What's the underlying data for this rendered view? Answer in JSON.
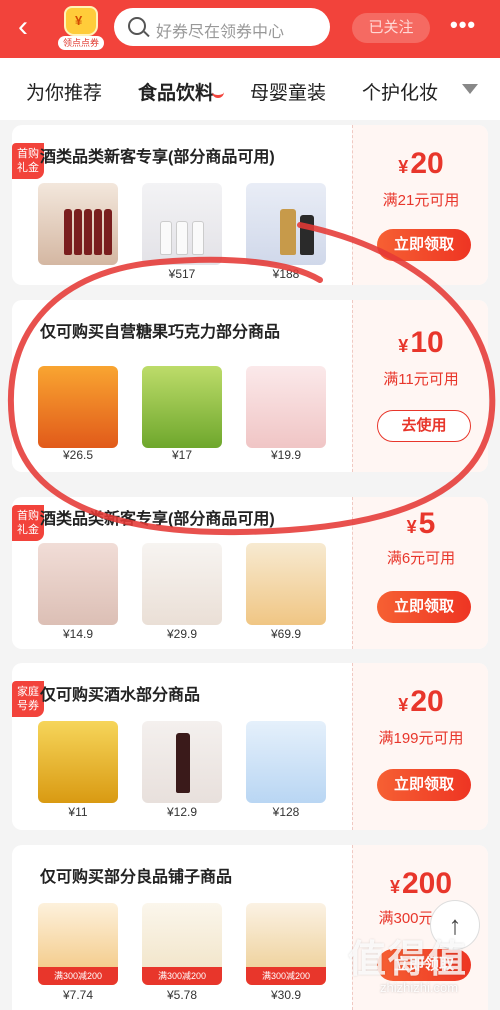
{
  "header": {
    "back_icon": "back-arrow-icon",
    "badge_label": "领点点券",
    "badge_char": "¥",
    "search_placeholder": "好券尽在领券中心",
    "follow_label": "已关注",
    "more_label": "•••"
  },
  "tabs": [
    {
      "label": "为你推荐",
      "active": false
    },
    {
      "label": "食品饮料",
      "active": true
    },
    {
      "label": "母婴童装",
      "active": false
    },
    {
      "label": "个护化妆",
      "active": false
    }
  ],
  "coupons": [
    {
      "tag": "首购礼金",
      "title": "酒类品类新客专享(部分商品可用)",
      "currency": "¥",
      "amount": "20",
      "condition": "满21元可用",
      "button": "立即领取",
      "products": [
        {
          "price": ""
        },
        {
          "price": "¥517"
        },
        {
          "price": "¥188"
        }
      ]
    },
    {
      "tag": "",
      "title": "仅可购买自营糖果巧克力部分商品",
      "currency": "¥",
      "amount": "10",
      "condition": "满11元可用",
      "button": "去使用",
      "products": [
        {
          "price": "¥26.5"
        },
        {
          "price": "¥17"
        },
        {
          "price": "¥19.9"
        }
      ]
    },
    {
      "tag": "首购礼金",
      "title": "酒类品类新客专享(部分商品可用)",
      "currency": "¥",
      "amount": "5",
      "condition": "满6元可用",
      "button": "立即领取",
      "products": [
        {
          "price": "¥14.9"
        },
        {
          "price": "¥29.9"
        },
        {
          "price": "¥69.9"
        }
      ]
    },
    {
      "tag": "家庭号券",
      "title": "仅可购买酒水部分商品",
      "currency": "¥",
      "amount": "20",
      "condition": "满199元可用",
      "button": "立即领取",
      "products": [
        {
          "price": "¥11"
        },
        {
          "price": "¥12.9"
        },
        {
          "price": "¥128"
        }
      ]
    },
    {
      "tag": "",
      "title": "仅可购买部分良品铺子商品",
      "currency": "¥",
      "amount": "200",
      "condition": "满300元可用",
      "button": "立即领取",
      "products": [
        {
          "price": "¥7.74",
          "promo": "满300减200"
        },
        {
          "price": "¥5.78",
          "promo": "满300减200"
        },
        {
          "price": "¥30.9",
          "promo": "满300减200"
        }
      ]
    }
  ],
  "scroll_top_icon": "arrow-up-icon",
  "watermark": {
    "main": "值得值",
    "sub": "zhizhizhi.com"
  }
}
